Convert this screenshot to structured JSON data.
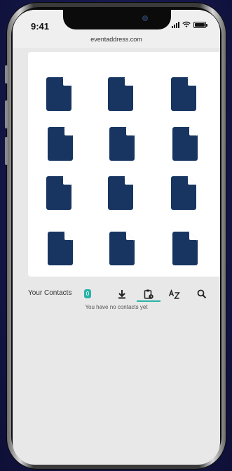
{
  "status_bar": {
    "time": "9:41"
  },
  "browser": {
    "url": "eventaddress.com"
  },
  "files": [
    {
      "icon": "document-icon"
    },
    {
      "icon": "document-icon"
    },
    {
      "icon": "document-icon"
    },
    {
      "icon": "document-icon"
    },
    {
      "icon": "document-icon"
    },
    {
      "icon": "document-icon"
    },
    {
      "icon": "document-icon"
    },
    {
      "icon": "document-icon"
    },
    {
      "icon": "document-icon"
    },
    {
      "icon": "document-icon"
    },
    {
      "icon": "document-icon"
    },
    {
      "icon": "document-icon"
    }
  ],
  "contacts": {
    "label": "Your Contacts",
    "count": "0",
    "empty_message": "You have no contacts yet",
    "toolbar": [
      "download-icon",
      "clipboard-icon",
      "sort-az-icon",
      "search-icon"
    ],
    "active_tab": "clipboard-icon"
  },
  "colors": {
    "document": "#173560",
    "accent": "#2ab3a7",
    "background": "#16184a",
    "screen": "#e8e8e8"
  }
}
